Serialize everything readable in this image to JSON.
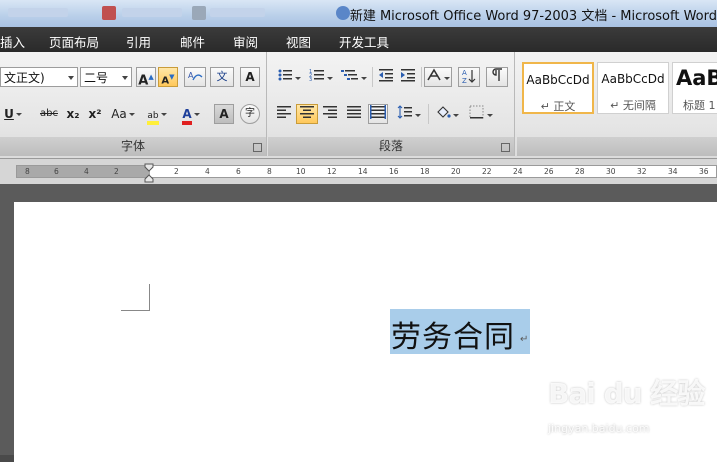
{
  "window": {
    "title": "新建 Microsoft Office Word 97-2003 文档 - Microsoft Word"
  },
  "menu": {
    "tabs": [
      "插入",
      "页面布局",
      "引用",
      "邮件",
      "审阅",
      "视图",
      "开发工具"
    ]
  },
  "ribbon": {
    "font_group": {
      "font_name": "文正文)",
      "font_size": "二号",
      "grow_font_label": "A",
      "shrink_font_label": "A",
      "pinyin_label": "文",
      "char_border_label": "A",
      "underline_label": "U",
      "strike_label": "abc",
      "subscript_label": "x₂",
      "superscript_label": "x²",
      "change_case_label": "Aa",
      "highlight_label": "ab",
      "font_color_label": "A",
      "char_shading_label": "A",
      "enclose_label": "字",
      "label": "字体"
    },
    "paragraph_group": {
      "label": "段落"
    },
    "styles": [
      {
        "sample": "AaBbCcDd",
        "name": "↵ 正文",
        "selected": true
      },
      {
        "sample": "AaBbCcDd",
        "name": "↵ 无间隔",
        "selected": false
      },
      {
        "sample": "AaB",
        "name": "标题 1",
        "selected": false
      }
    ]
  },
  "ruler": {
    "left_numbers": [
      "8",
      "6",
      "4",
      "2"
    ],
    "right_numbers": [
      "2",
      "4",
      "6",
      "8",
      "10",
      "12",
      "14",
      "16",
      "18",
      "20",
      "22",
      "24",
      "26",
      "28",
      "30",
      "32",
      "34",
      "36"
    ]
  },
  "document": {
    "text": "劳务合同",
    "paragraph_mark": "↵"
  },
  "watermark": {
    "logo": "Bai du 经验",
    "url": "jingyan.baidu.com"
  },
  "colors": {
    "selection": "#a9cdea",
    "menubar": "#2e2e2e",
    "active_button": "#ffc85a"
  }
}
